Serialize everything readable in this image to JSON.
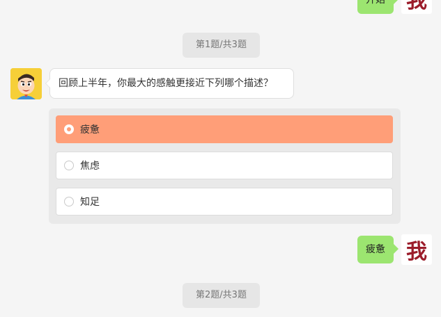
{
  "messages": {
    "top_partial_text": "开始",
    "me_avatar_char": "我",
    "q1_progress": "第1题/共3题",
    "q1_text": "回顾上半年，你最大的感触更接近下列哪个描述？",
    "answer_text": "疲惫",
    "q2_progress": "第2题/共3题"
  },
  "options": [
    {
      "label": "疲惫",
      "selected": true
    },
    {
      "label": "焦虑",
      "selected": false
    },
    {
      "label": "知足",
      "selected": false
    }
  ],
  "colors": {
    "selected_option": "#ff9e78",
    "user_bubble": "#9ce570",
    "me_avatar_text": "#9b1c2a",
    "bot_avatar_bg": "#f6cf38"
  }
}
